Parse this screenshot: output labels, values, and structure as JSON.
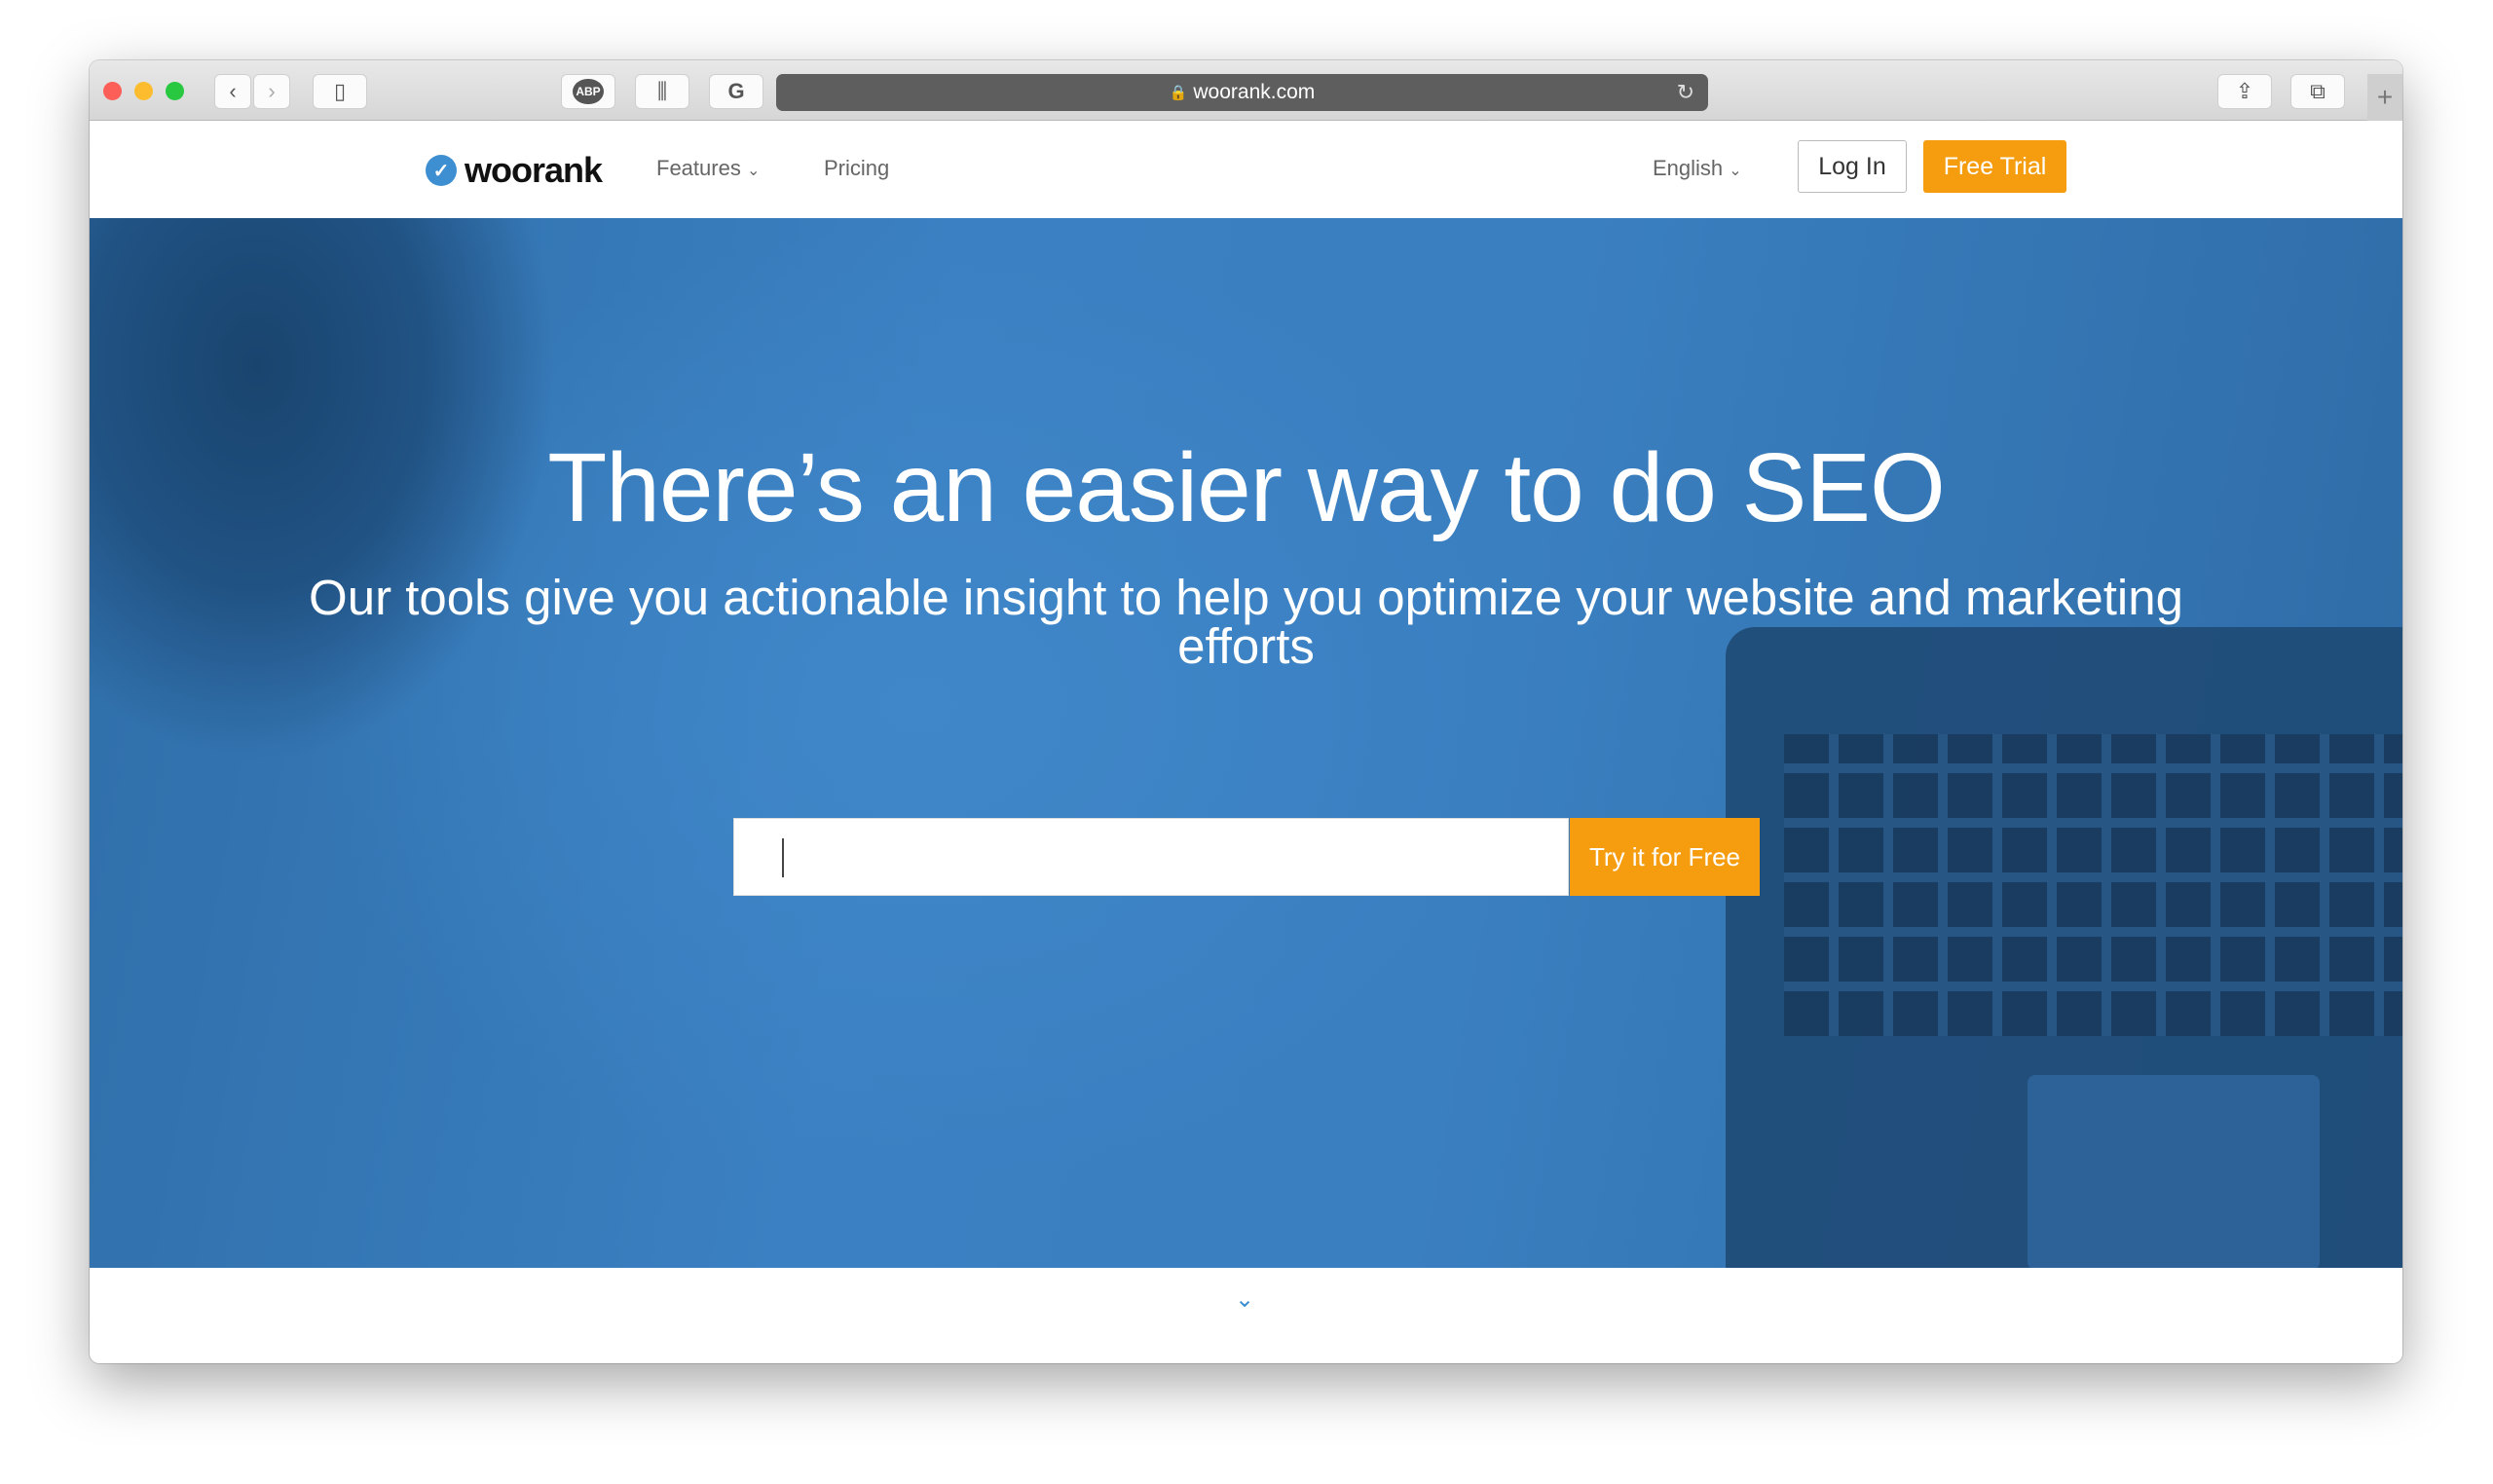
{
  "browser": {
    "url": "woorank.com",
    "extensions": [
      "ABP",
      "bars",
      "G"
    ]
  },
  "nav": {
    "logo": "woorank",
    "links": [
      {
        "label": "Features"
      },
      {
        "label": "Pricing"
      }
    ],
    "language": "English",
    "login": "Log In",
    "free_trial": "Free Trial"
  },
  "hero": {
    "title": "There’s an easier way to do SEO",
    "subtitle": "Our tools give you actionable insight to help you optimize your website and marketing efforts",
    "input_value": "",
    "button": "Try it for Free"
  },
  "colors": {
    "accent": "#f59d0f",
    "brand": "#3e8fd1",
    "hero": "#3a7fc0"
  }
}
